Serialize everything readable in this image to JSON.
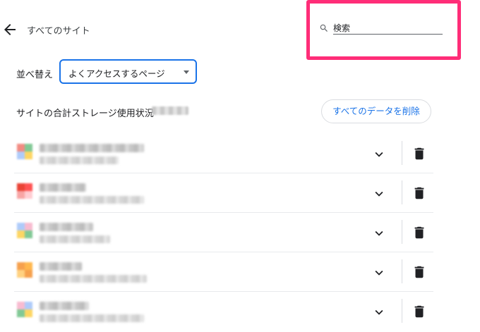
{
  "header": {
    "back_icon": "arrow-back-icon",
    "title": "すべてのサイト"
  },
  "search": {
    "icon": "search-icon",
    "placeholder": "検索"
  },
  "sort": {
    "label": "並べ替え",
    "selected": "よくアクセスするページ"
  },
  "storage": {
    "label": "サイトの合計ストレージ使用状況"
  },
  "actions": {
    "clear_all": "すべてのデータを削除"
  },
  "sites": [
    {
      "favicon_colors": [
        "#f28b82",
        "#81c995",
        "#aecbfa",
        "#fdd663"
      ]
    },
    {
      "favicon_colors": [
        "#ea4335",
        "#ff5252",
        "#f8a5a5",
        "#ffcdd2"
      ]
    },
    {
      "favicon_colors": [
        "#aecbfa",
        "#f8bbd0",
        "#fdd663",
        "#81c995"
      ]
    },
    {
      "favicon_colors": [
        "#f6a04d",
        "#ffb74d",
        "#ffd180",
        "#f6a04d"
      ]
    },
    {
      "favicon_colors": [
        "#f8bbd0",
        "#aecbfa",
        "#81c995",
        "#fdd663"
      ]
    }
  ],
  "icons": {
    "expand": "chevron-down-icon",
    "delete": "trash-icon"
  },
  "colors": {
    "accent": "#1a73e8",
    "highlight": "#ff2d78"
  }
}
